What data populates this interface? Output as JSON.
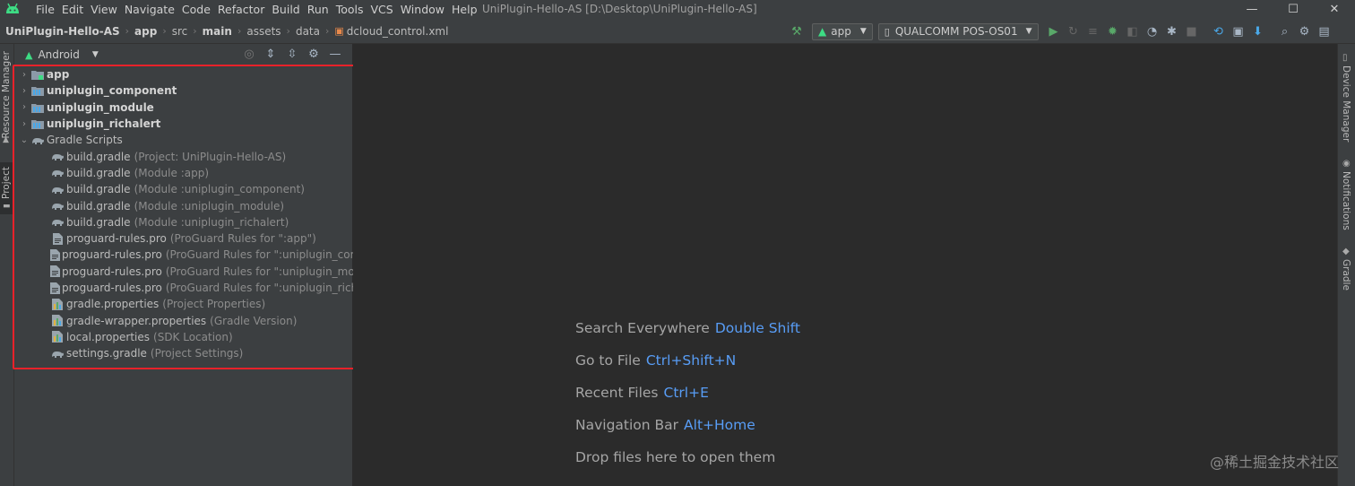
{
  "menu": [
    "File",
    "Edit",
    "View",
    "Navigate",
    "Code",
    "Refactor",
    "Build",
    "Run",
    "Tools",
    "VCS",
    "Window",
    "Help"
  ],
  "window_title": "UniPlugin-Hello-AS [D:\\Desktop\\UniPlugin-Hello-AS]",
  "window_controls": {
    "minimize": "—",
    "maximize": "☐",
    "close": "✕"
  },
  "breadcrumb": [
    "UniPlugin-Hello-AS",
    "app",
    "src",
    "main",
    "assets",
    "data",
    "dcloud_control.xml"
  ],
  "toolbar": {
    "run_config": "app",
    "device": "QUALCOMM POS-OS01"
  },
  "left_strip": {
    "resource_manager": "Resource Manager",
    "project": "Project"
  },
  "right_strip": {
    "device_manager": "Device Manager",
    "notifications": "Notifications",
    "gradle": "Gradle"
  },
  "panel": {
    "view_mode": "Android"
  },
  "tree": [
    {
      "name": "app",
      "extra": "",
      "type": "module-folder",
      "bold": true,
      "arrow": "›",
      "level": 0
    },
    {
      "name": "uniplugin_component",
      "extra": "",
      "type": "module",
      "bold": true,
      "arrow": "›",
      "level": 0
    },
    {
      "name": "uniplugin_module",
      "extra": "",
      "type": "module",
      "bold": true,
      "arrow": "›",
      "level": 0
    },
    {
      "name": "uniplugin_richalert",
      "extra": "",
      "type": "module",
      "bold": true,
      "arrow": "›",
      "level": 0
    },
    {
      "name": "Gradle Scripts",
      "extra": "",
      "type": "gradle",
      "bold": false,
      "arrow": "⌄",
      "level": 0
    },
    {
      "name": "build.gradle",
      "extra": "(Project: UniPlugin-Hello-AS)",
      "type": "gradle",
      "bold": false,
      "arrow": "",
      "level": 1
    },
    {
      "name": "build.gradle",
      "extra": "(Module :app)",
      "type": "gradle",
      "bold": false,
      "arrow": "",
      "level": 1
    },
    {
      "name": "build.gradle",
      "extra": "(Module :uniplugin_component)",
      "type": "gradle",
      "bold": false,
      "arrow": "",
      "level": 1
    },
    {
      "name": "build.gradle",
      "extra": "(Module :uniplugin_module)",
      "type": "gradle",
      "bold": false,
      "arrow": "",
      "level": 1
    },
    {
      "name": "build.gradle",
      "extra": "(Module :uniplugin_richalert)",
      "type": "gradle",
      "bold": false,
      "arrow": "",
      "level": 1
    },
    {
      "name": "proguard-rules.pro",
      "extra": "(ProGuard Rules for \":app\")",
      "type": "file",
      "bold": false,
      "arrow": "",
      "level": 1
    },
    {
      "name": "proguard-rules.pro",
      "extra": "(ProGuard Rules for \":uniplugin_compon",
      "type": "file",
      "bold": false,
      "arrow": "",
      "level": 1
    },
    {
      "name": "proguard-rules.pro",
      "extra": "(ProGuard Rules for \":uniplugin_module\"",
      "type": "file",
      "bold": false,
      "arrow": "",
      "level": 1
    },
    {
      "name": "proguard-rules.pro",
      "extra": "(ProGuard Rules for \":uniplugin_richalert",
      "type": "file",
      "bold": false,
      "arrow": "",
      "level": 1
    },
    {
      "name": "gradle.properties",
      "extra": "(Project Properties)",
      "type": "props",
      "bold": false,
      "arrow": "",
      "level": 1
    },
    {
      "name": "gradle-wrapper.properties",
      "extra": "(Gradle Version)",
      "type": "props",
      "bold": false,
      "arrow": "",
      "level": 1
    },
    {
      "name": "local.properties",
      "extra": "(SDK Location)",
      "type": "props",
      "bold": false,
      "arrow": "",
      "level": 1
    },
    {
      "name": "settings.gradle",
      "extra": "(Project Settings)",
      "type": "gradle",
      "bold": false,
      "arrow": "",
      "level": 1
    }
  ],
  "hints": [
    {
      "label": "Search Everywhere",
      "key": "Double Shift"
    },
    {
      "label": "Go to File",
      "key": "Ctrl+Shift+N"
    },
    {
      "label": "Recent Files",
      "key": "Ctrl+E"
    },
    {
      "label": "Navigation Bar",
      "key": "Alt+Home"
    },
    {
      "label": "Drop files here to open them",
      "key": ""
    }
  ],
  "watermark": "@稀土掘金技术社区",
  "colors": {
    "accent": "#589df6",
    "highlight_box": "#e8222a",
    "android_green": "#3ddc84"
  }
}
